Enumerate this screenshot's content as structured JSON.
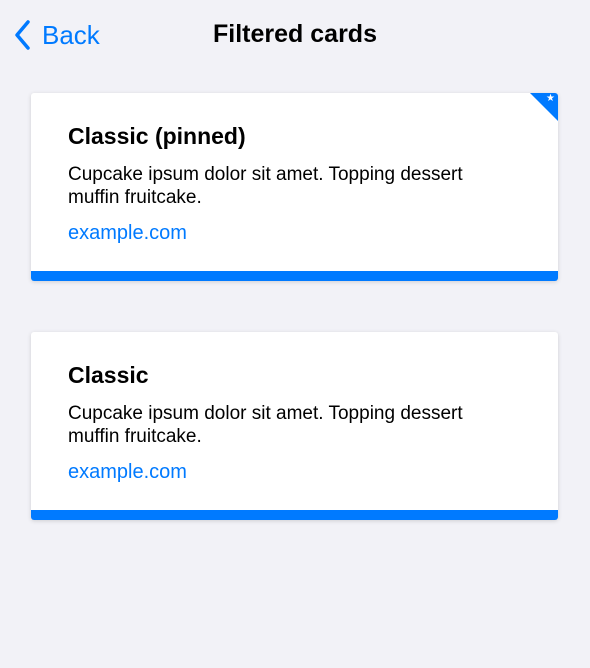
{
  "nav": {
    "back_label": "Back",
    "title": "Filtered cards"
  },
  "cards": [
    {
      "title": "Classic (pinned)",
      "description": "Cupcake ipsum dolor sit amet. Topping dessert muffin fruitcake.",
      "link": "example.com",
      "pinned": true
    },
    {
      "title": "Classic",
      "description": "Cupcake ipsum dolor sit amet. Topping dessert muffin fruitcake.",
      "link": "example.com",
      "pinned": false
    }
  ],
  "colors": {
    "accent": "#007aff",
    "background": "#f2f2f7"
  }
}
